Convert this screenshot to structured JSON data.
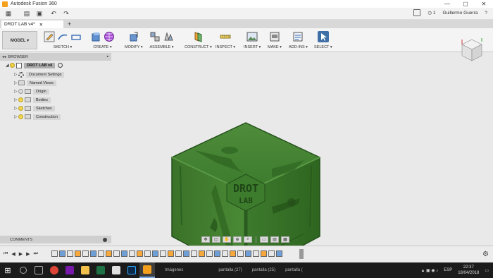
{
  "window": {
    "title": "Autodesk Fusion 360",
    "controls": [
      "—",
      "▢",
      "✕"
    ]
  },
  "quick_access": {
    "user_name": "Guillermo Guerra",
    "jobs_count": "1",
    "help_label": "?"
  },
  "document_tab": {
    "title": "DROT LAB v4*",
    "close": "✕",
    "new_tab": "+"
  },
  "ribbon": {
    "workspace": "MODEL ▾",
    "groups": [
      {
        "label": "SKETCH ▾"
      },
      {
        "label": "CREATE ▾"
      },
      {
        "label": "MODIFY ▾"
      },
      {
        "label": "ASSEMBLE ▾"
      },
      {
        "label": "CONSTRUCT ▾"
      },
      {
        "label": "INSPECT ▾"
      },
      {
        "label": "INSERT ▾"
      },
      {
        "label": "MAKE ▾"
      },
      {
        "label": "ADD-INS ▾"
      },
      {
        "label": "SELECT ▾"
      }
    ]
  },
  "browser": {
    "header": "BROWSER",
    "root": "DROT LAB v4",
    "items": [
      {
        "label": "Document Settings"
      },
      {
        "label": "Named Views"
      },
      {
        "label": "Origin"
      },
      {
        "label": "Bodies"
      },
      {
        "label": "Sketches"
      },
      {
        "label": "Construction"
      }
    ]
  },
  "model": {
    "text_line1": "DROT",
    "text_line2": "LAB",
    "body_color": "#3f7b2d"
  },
  "comments": {
    "label": "COMMENTS"
  },
  "taskbar": {
    "task_items": [
      "Imágenes",
      "pantalla (27)",
      "pantalla (25)",
      "pantalla ("
    ],
    "language": "ESP",
    "time": "22:37",
    "date": "18/04/2018"
  }
}
